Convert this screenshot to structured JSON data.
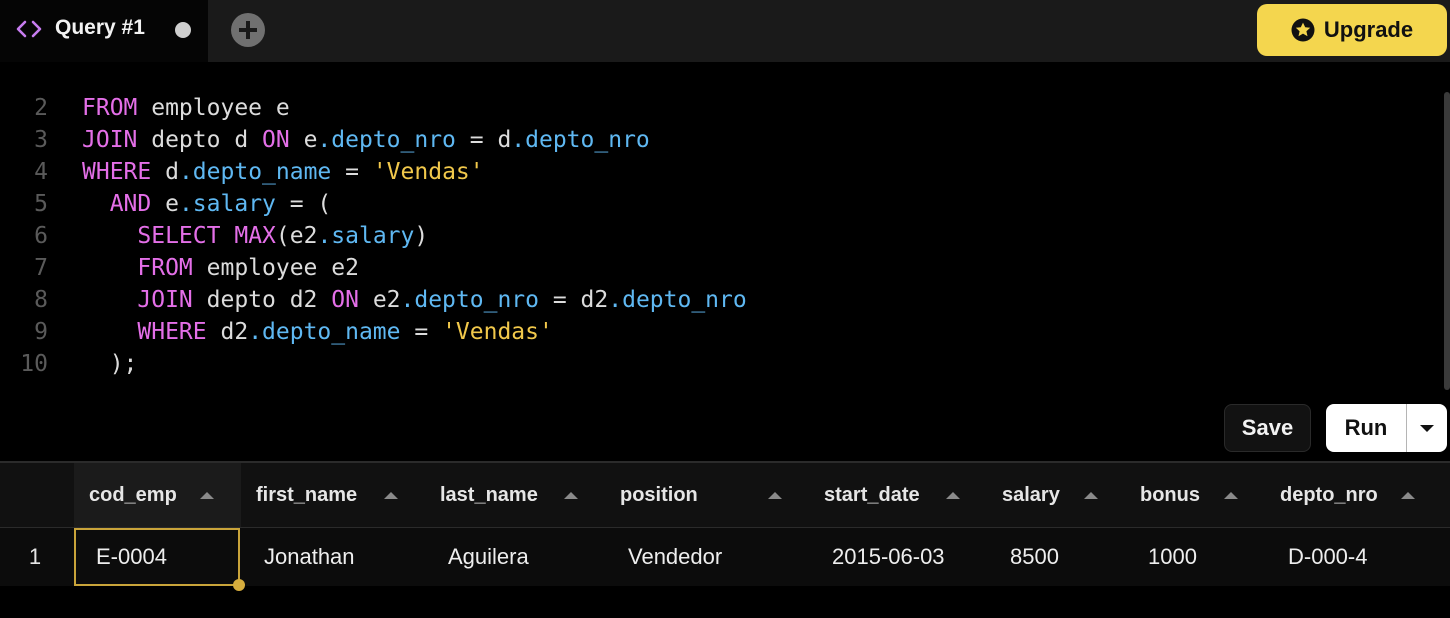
{
  "tabs": [
    {
      "label": "Query #1",
      "icon": "code-icon",
      "unsaved": true
    }
  ],
  "add_tab_icon": "plus-icon",
  "upgrade_button": {
    "label": "Upgrade",
    "icon": "star-icon"
  },
  "editor": {
    "lines": [
      {
        "number": "2",
        "tokens": [
          [
            "kw",
            "FROM"
          ],
          [
            "t",
            " employee e"
          ]
        ]
      },
      {
        "number": "3",
        "tokens": [
          [
            "kw",
            "JOIN"
          ],
          [
            "t",
            " depto d "
          ],
          [
            "kw",
            "ON"
          ],
          [
            "t",
            " e"
          ],
          [
            "prop",
            ".depto_nro"
          ],
          [
            "t",
            " = d"
          ],
          [
            "prop",
            ".depto_nro"
          ]
        ]
      },
      {
        "number": "4",
        "tokens": [
          [
            "kw",
            "WHERE"
          ],
          [
            "t",
            " d"
          ],
          [
            "prop",
            ".depto_name"
          ],
          [
            "t",
            " = "
          ],
          [
            "str",
            "'Vendas'"
          ]
        ]
      },
      {
        "number": "5",
        "tokens": [
          [
            "t",
            "  "
          ],
          [
            "kw",
            "AND"
          ],
          [
            "t",
            " e"
          ],
          [
            "prop",
            ".salary"
          ],
          [
            "t",
            " = ("
          ]
        ]
      },
      {
        "number": "6",
        "tokens": [
          [
            "t",
            "    "
          ],
          [
            "kw",
            "SELECT"
          ],
          [
            "t",
            " "
          ],
          [
            "kw",
            "MAX"
          ],
          [
            "t",
            "(e2"
          ],
          [
            "prop",
            ".salary"
          ],
          [
            "t",
            ")"
          ]
        ]
      },
      {
        "number": "7",
        "tokens": [
          [
            "t",
            "    "
          ],
          [
            "kw",
            "FROM"
          ],
          [
            "t",
            " employee e2"
          ]
        ]
      },
      {
        "number": "8",
        "tokens": [
          [
            "t",
            "    "
          ],
          [
            "kw",
            "JOIN"
          ],
          [
            "t",
            " depto d2 "
          ],
          [
            "kw",
            "ON"
          ],
          [
            "t",
            " e2"
          ],
          [
            "prop",
            ".depto_nro"
          ],
          [
            "t",
            " = d2"
          ],
          [
            "prop",
            ".depto_nro"
          ]
        ]
      },
      {
        "number": "9",
        "tokens": [
          [
            "t",
            "    "
          ],
          [
            "kw",
            "WHERE"
          ],
          [
            "t",
            " d2"
          ],
          [
            "prop",
            ".depto_name"
          ],
          [
            "t",
            " = "
          ],
          [
            "str",
            "'Vendas'"
          ]
        ]
      },
      {
        "number": "10",
        "tokens": [
          [
            "t",
            "  );"
          ]
        ]
      }
    ]
  },
  "actions": {
    "save_label": "Save",
    "run_label": "Run",
    "run_menu_icon": "caret-down-icon"
  },
  "results": {
    "columns": [
      "cod_emp",
      "first_name",
      "last_name",
      "position",
      "start_date",
      "salary",
      "bonus",
      "depto_nro"
    ],
    "rows": [
      {
        "row_number": "1",
        "cells": [
          "E-0004",
          "Jonathan",
          "Aguilera",
          "Vendedor",
          "2015-06-03",
          "8500",
          "1000",
          "D-000-4"
        ]
      }
    ],
    "selected_cell": "cod_emp"
  },
  "colors": {
    "keyword": "#e46fe8",
    "property": "#5fb8f2",
    "string": "#f1c84b",
    "upgrade_bg": "#f4d64e",
    "selection_border": "#c9a43a"
  }
}
